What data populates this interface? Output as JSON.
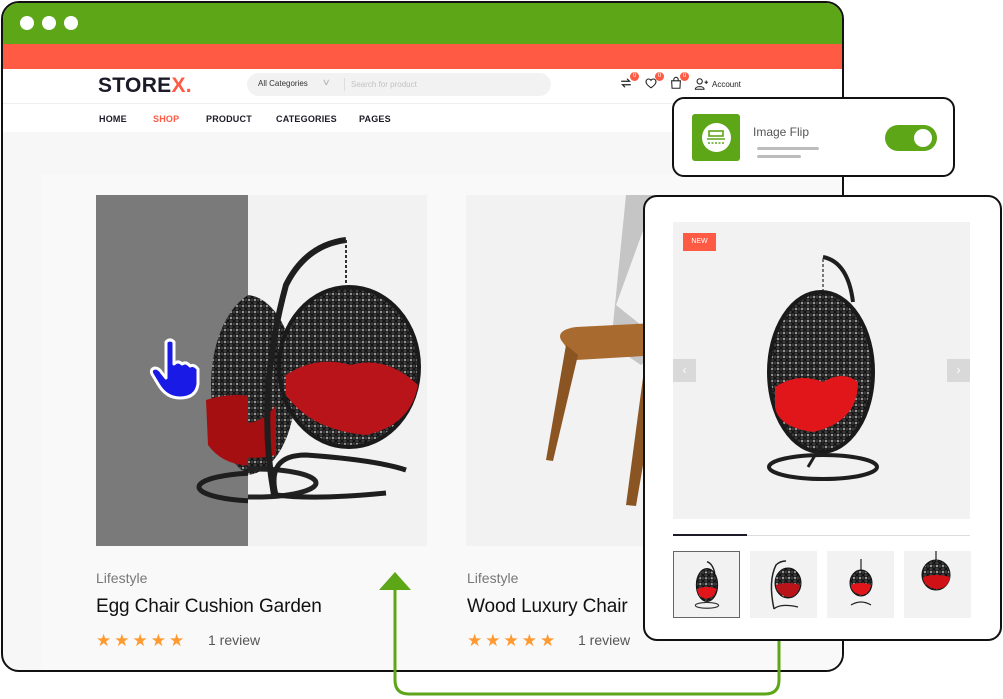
{
  "browser": {
    "window_controls": [
      "dot",
      "dot",
      "dot"
    ],
    "colors": {
      "titlebar": "#5da618",
      "promo_bar": "#ff5a43",
      "accent": "#ff5a43"
    }
  },
  "header": {
    "logo_main": "STORE",
    "logo_accent": "X.",
    "search": {
      "category_selected": "All Categories",
      "placeholder": "Search for product",
      "value": ""
    },
    "icons": [
      {
        "name": "compare-icon",
        "badge": "0"
      },
      {
        "name": "wishlist-icon",
        "badge": "0"
      },
      {
        "name": "cart-icon",
        "badge": "0"
      }
    ],
    "account_label": "Account"
  },
  "nav": {
    "items": [
      {
        "label": "HOME",
        "active": false
      },
      {
        "label": "SHOP",
        "active": true
      },
      {
        "label": "PRODUCT",
        "active": false
      },
      {
        "label": "CATEGORIES",
        "active": false
      },
      {
        "label": "PAGES",
        "active": false
      }
    ]
  },
  "products": [
    {
      "category": "Lifestyle",
      "title": "Egg Chair Cushion Garden",
      "rating": 5,
      "rating_max": 5,
      "reviews": "1 review"
    },
    {
      "category": "Lifestyle",
      "title": "Wood Luxury Chair",
      "rating": 5,
      "rating_max": 5,
      "reviews": "1 review"
    }
  ],
  "image_flip": {
    "title": "Image Flip",
    "enabled": true,
    "icon": "image-flip-icon"
  },
  "detail": {
    "badge": "NEW",
    "prev_icon": "‹",
    "next_icon": "›",
    "gallery_progress": 0.25,
    "thumbnails": [
      {
        "label": "egg-chair-front",
        "active": true
      },
      {
        "label": "egg-chair-side",
        "active": false
      },
      {
        "label": "egg-chair-stand",
        "active": false
      },
      {
        "label": "egg-chair-hanging",
        "active": false
      }
    ]
  },
  "stars_glyph": "★"
}
